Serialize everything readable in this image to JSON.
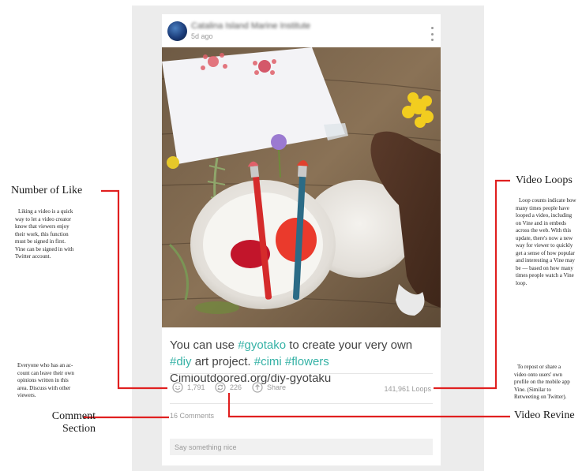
{
  "post": {
    "author": "Catalina Island Marine Institute",
    "time": "5d ago",
    "caption_parts": [
      {
        "text": "You can use ",
        "tag": false
      },
      {
        "text": "#gyotako",
        "tag": true
      },
      {
        "text": " to create your very own ",
        "tag": false
      },
      {
        "text": "#diy",
        "tag": true
      },
      {
        "text": " art project. ",
        "tag": false
      },
      {
        "text": "#cimi",
        "tag": true
      },
      {
        "text": " ",
        "tag": false
      },
      {
        "text": "#flowers",
        "tag": true
      },
      {
        "text": " Cimioutdoored.org/diy-gyotaku",
        "tag": false
      }
    ],
    "likes": "1,791",
    "revines": "226",
    "share_label": "Share",
    "loops": "141,961 Loops",
    "comments_count": "16 Comments",
    "comment_placeholder": "Say something nice"
  },
  "icons": {
    "like": "smiley-icon",
    "revine": "revine-icon",
    "share": "share-arrow-icon",
    "menu": "more-vertical-icon"
  },
  "colors": {
    "hashtag": "#36b2a6",
    "leader_line": "#e02020",
    "panel": "#ececec"
  },
  "annotations": {
    "likes": {
      "title": "Number of Like",
      "lines": [
        "Liking a video is a quick",
        "way to let a video creator",
        "know that viewers enjoy",
        "their work, this function",
        "must be signed in first.",
        "Vine can be signed in with",
        "Twitter account."
      ]
    },
    "comments_note": {
      "lines": [
        "Everyone who has an ac-",
        "count can leave their own",
        "opinions written in this",
        "area. Discuss with other",
        "viewers."
      ]
    },
    "comment_section": {
      "title_line1": "Comment",
      "title_line2": "Section"
    },
    "loops": {
      "title": "Video Loops",
      "lines": [
        "Loop counts indicate how",
        "many times people have",
        "looped a video, including",
        "on Vine and in embeds",
        "across the web. With this",
        "update, there's now a new",
        "way for viewer to quickly",
        "get a sense of how popular",
        "and interesting a Vine may",
        "be — based on how many",
        "times people watch a Vine",
        "loop."
      ]
    },
    "revine": {
      "title": "Video Revine",
      "lines": [
        "To repost or share a",
        "video onto users' own",
        "profile on the mobile app",
        "Vine. (Similar to",
        "Retweeting on Twitter)."
      ]
    }
  }
}
